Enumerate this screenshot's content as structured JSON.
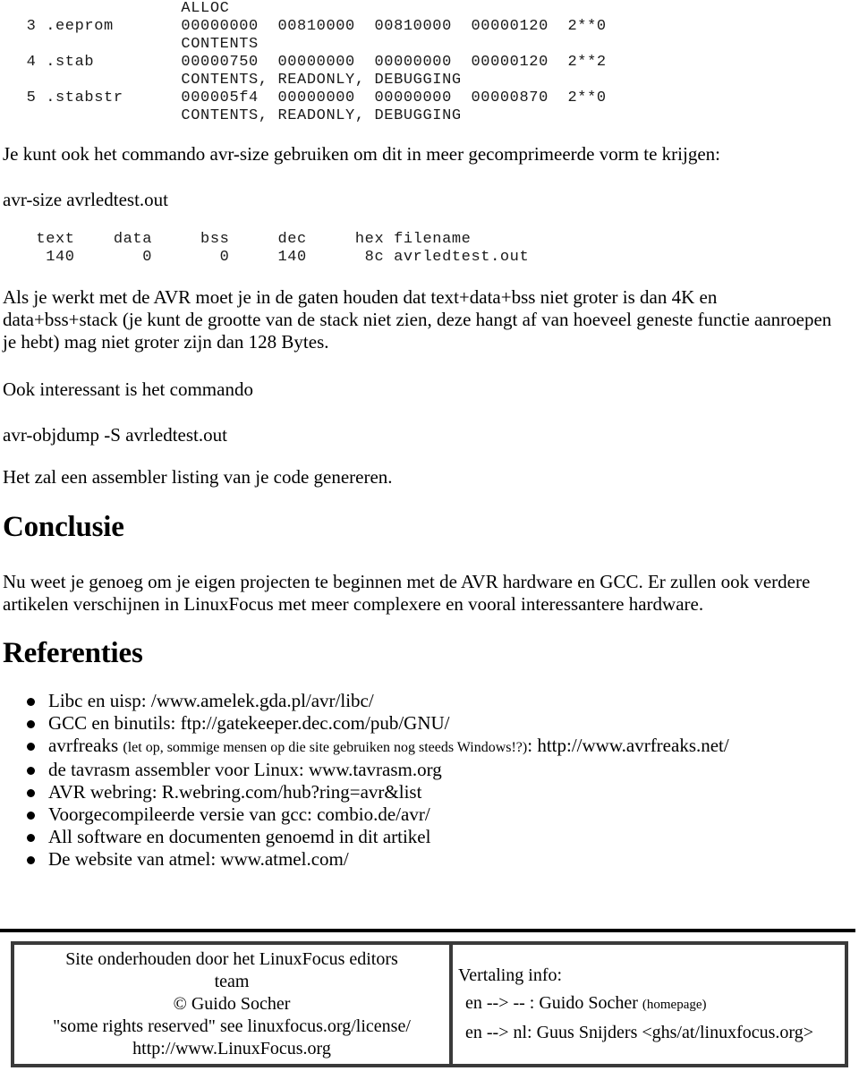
{
  "objdump_output": "                  ALLOC\n  3 .eeprom       00000000  00810000  00810000  00000120  2**0\n                  CONTENTS\n  4 .stab         00000750  00000000  00000000  00000120  2**2\n                  CONTENTS, READONLY, DEBUGGING\n  5 .stabstr      000005f4  00000000  00000000  00000870  2**0\n                  CONTENTS, READONLY, DEBUGGING",
  "paragraphs": {
    "avrsize_intro": "Je kunt ook het commando avr-size gebruiken om dit in meer gecomprimeerde vorm te krijgen:",
    "avrsize_command": "avr-size avrledtest.out",
    "limits": "Als je werkt met de AVR moet je in de gaten houden dat text+data+bss niet groter is dan 4K en data+bss+stack (je kunt de grootte van de stack niet zien, deze hangt af van hoeveel geneste functie aanroepen je hebt) mag niet groter zijn dan 128 Bytes.",
    "ook_interessant": "Ook interessant is het commando",
    "objdump_command": "avr-objdump -S avrledtest.out",
    "objdump_note": "Het zal een assembler listing van je code genereren.",
    "conclusion": "Nu weet je genoeg om je eigen projecten te beginnen met de AVR hardware en GCC. Er zullen ook verdere artikelen verschijnen in LinuxFocus met meer complexere en vooral interessantere hardware."
  },
  "avrsize_output": "   text    data     bss     dec     hex filename\n    140       0       0     140      8c avrledtest.out",
  "avrsize_table": {
    "columns": [
      "text",
      "data",
      "bss",
      "dec",
      "hex",
      "filename"
    ],
    "rows": [
      [
        "140",
        "0",
        "0",
        "140",
        "8c",
        "avrledtest.out"
      ]
    ]
  },
  "headings": {
    "conclusie": "Conclusie",
    "referenties": "Referenties"
  },
  "references": [
    {
      "text": "Libc en uisp: /www.amelek.gda.pl/avr/libc/"
    },
    {
      "text": "GCC en binutils: ftp://gatekeeper.dec.com/pub/GNU/"
    },
    {
      "prefix": "avrfreaks ",
      "note": "(let op, sommige mensen op die site gebruiken nog steeds Windows!?)",
      "suffix": ": http://www.avrfreaks.net/"
    },
    {
      "text": "de tavrasm assembler voor Linux: www.tavrasm.org"
    },
    {
      "text": "AVR webring: R.webring.com/hub?ring=avr&list"
    },
    {
      "text": "Voorgecompileerde versie van gcc: combio.de/avr/"
    },
    {
      "text": "All software en documenten genoemd in dit artikel"
    },
    {
      "text": "De website van atmel: www.atmel.com/"
    }
  ],
  "footer": {
    "left": {
      "line1": "Site onderhouden door het LinuxFocus editors",
      "line2": "team",
      "line3": "© Guido Socher",
      "line4": "\"some rights reserved\" see linuxfocus.org/license/",
      "line5": "http://www.LinuxFocus.org"
    },
    "right": {
      "title": "Vertaling info:",
      "line1_main": "en --> -- : Guido Socher ",
      "line1_note": "(homepage)",
      "line2": "en --> nl: Guus Snijders <ghs/at/linuxfocus.org>"
    }
  }
}
